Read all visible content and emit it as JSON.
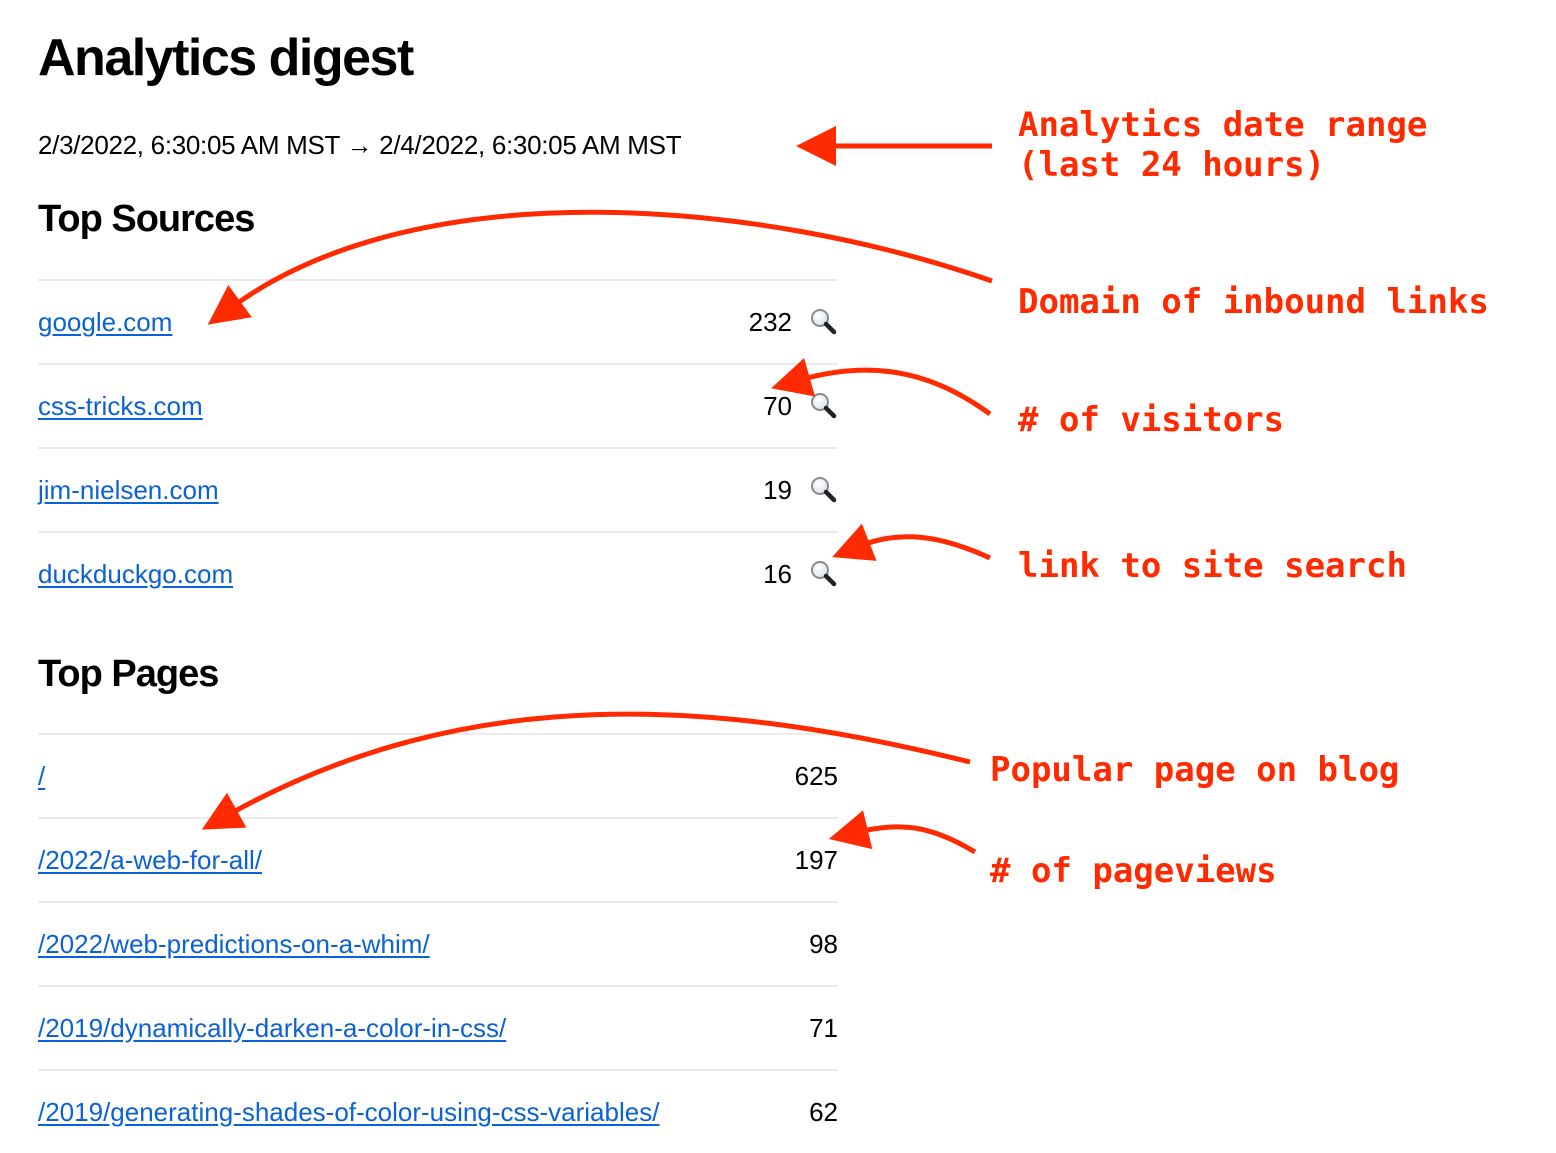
{
  "page": {
    "title": "Analytics digest",
    "date_range": "2/3/2022, 6:30:05 AM MST → 2/4/2022, 6:30:05 AM MST"
  },
  "top_sources": {
    "heading": "Top Sources",
    "rows": [
      {
        "domain": "google.com",
        "count": "232",
        "icon": "search-icon"
      },
      {
        "domain": "css-tricks.com",
        "count": "70",
        "icon": "search-icon"
      },
      {
        "domain": "jim-nielsen.com",
        "count": "19",
        "icon": "search-icon"
      },
      {
        "domain": "duckduckgo.com",
        "count": "16",
        "icon": "search-icon"
      }
    ]
  },
  "top_pages": {
    "heading": "Top Pages",
    "rows": [
      {
        "path": "/",
        "count": "625"
      },
      {
        "path": "/2022/a-web-for-all/",
        "count": "197"
      },
      {
        "path": "/2022/web-predictions-on-a-whim/",
        "count": "98"
      },
      {
        "path": "/2019/dynamically-darken-a-color-in-css/",
        "count": "71"
      },
      {
        "path": "/2019/generating-shades-of-color-using-css-variables/",
        "count": "62"
      }
    ]
  },
  "annotations": {
    "date_range": "Analytics date range\n(last 24 hours)",
    "domain": "Domain of inbound links",
    "visitors": "# of visitors",
    "site_search": "link to site search",
    "popular_page": "Popular page on blog",
    "pageviews": "# of pageviews",
    "color": "#ff2a00"
  },
  "colors": {
    "link": "#0b62d6",
    "divider": "#ebebeb"
  }
}
